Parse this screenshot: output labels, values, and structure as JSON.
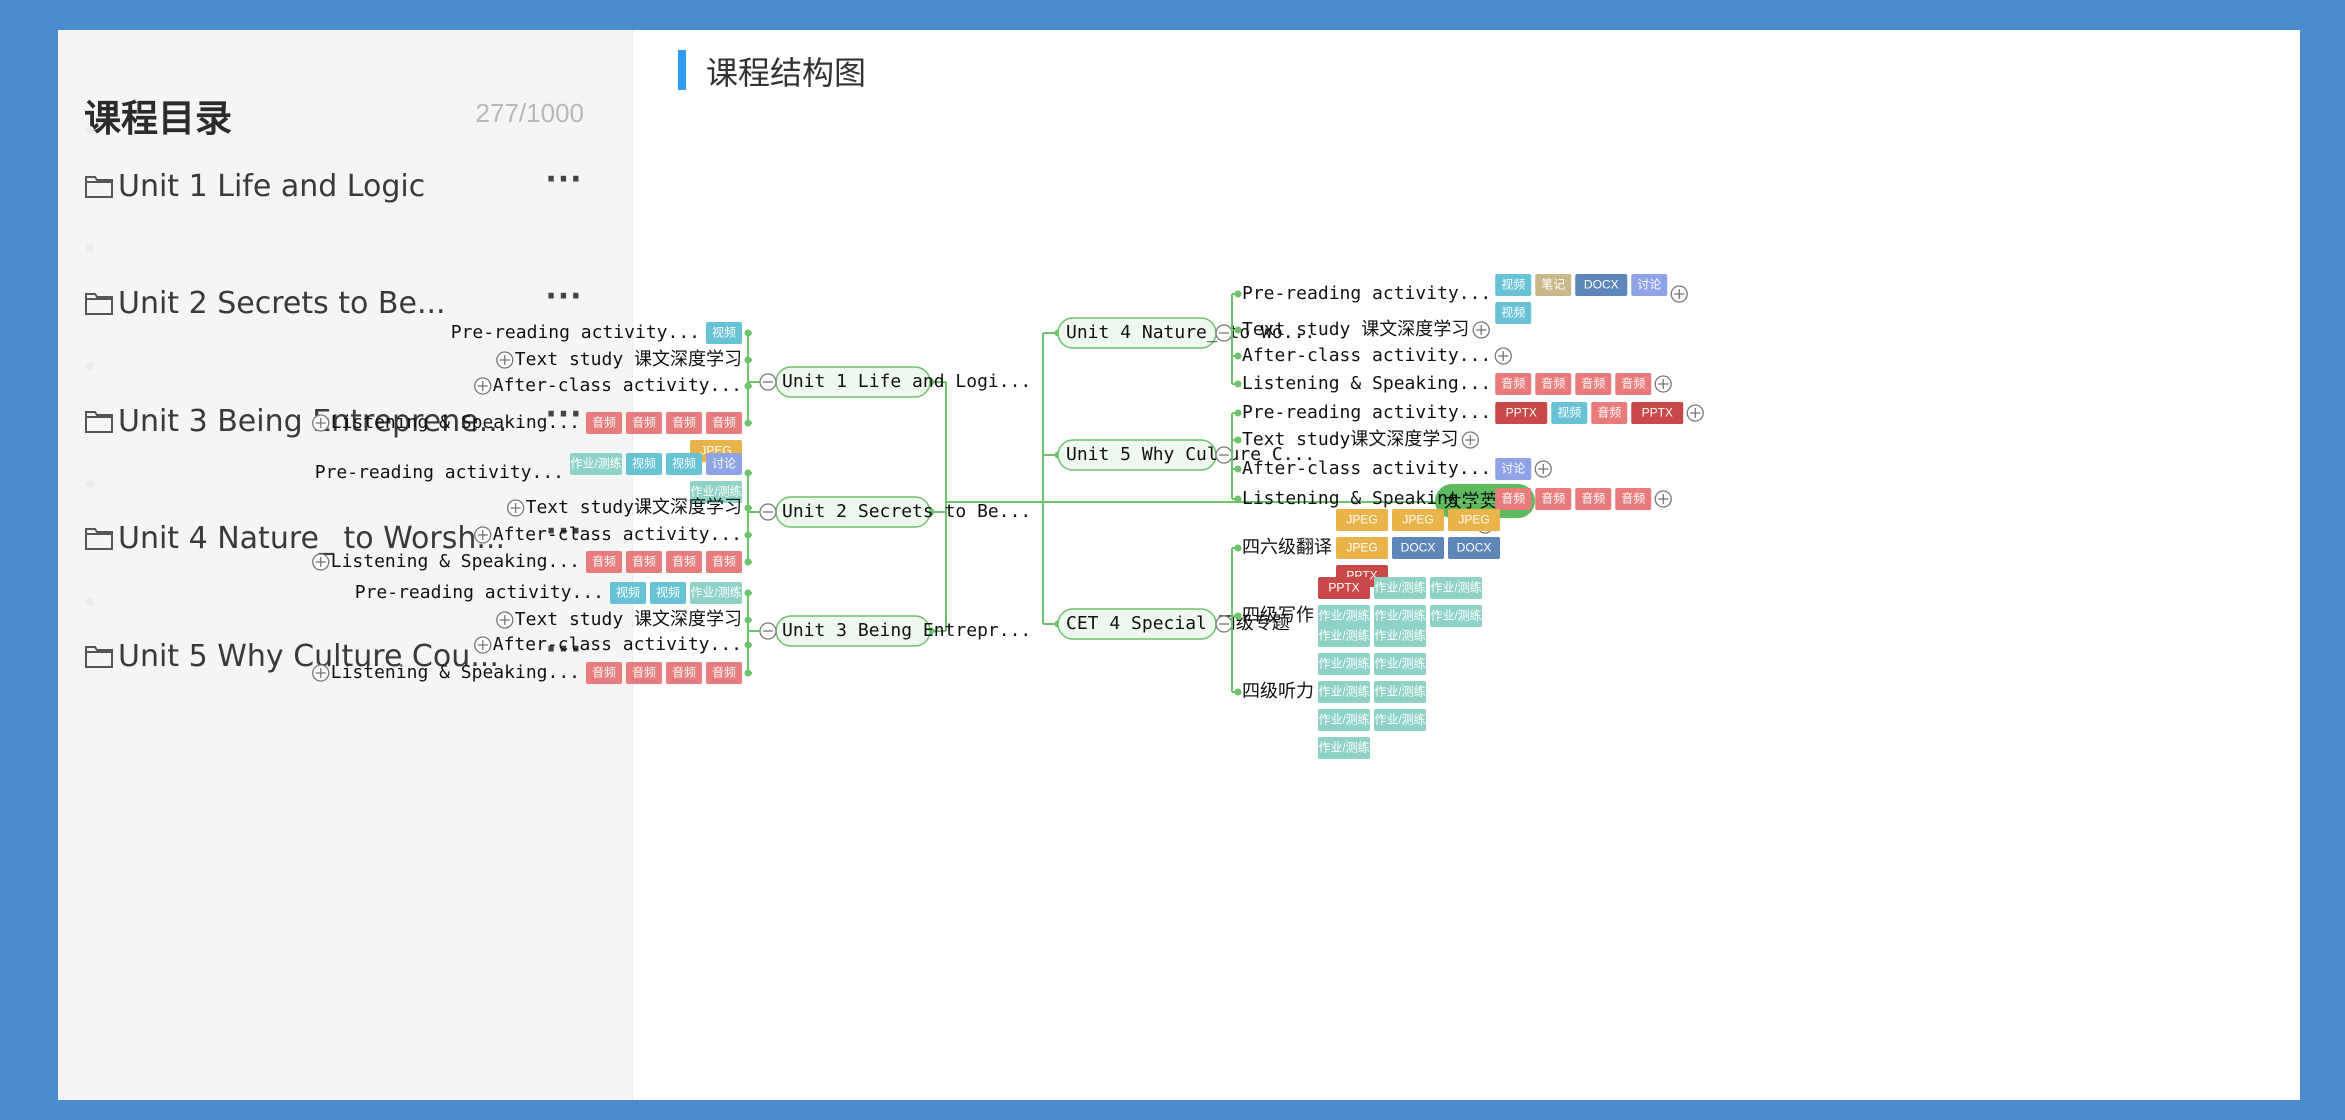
{
  "sidebar": {
    "title": "课程目录",
    "count": "277/1000",
    "items": [
      {
        "label": "Unit 1 Life and Logic"
      },
      {
        "label": "Unit 2 Secrets to Be..."
      },
      {
        "label": "Unit 3 Being Entreprene..."
      },
      {
        "label": "Unit 4 Nature_ to Worsh..."
      },
      {
        "label": "Unit 5 Why Culture Cou..."
      }
    ],
    "more_label": "···"
  },
  "main": {
    "title": "课程结构图"
  },
  "mindmap": {
    "root": "大学英语3",
    "colors": {
      "line": "#6cc36c",
      "node_bg": "#eef8ee",
      "root_bg": "#5dbb5d",
      "音频": "#e87b7b",
      "视频": "#67c2d6",
      "作业/测练": "#8fd3c6",
      "讨论": "#8fa3e6",
      "JPEG": "#e8b44a",
      "DOCX": "#5f86b8",
      "PPTX": "#c9494b",
      "笔记": "#c9b88a"
    },
    "left_units": [
      {
        "label": "Unit 1 Life and Logi...",
        "children": [
          {
            "label": "Pre-reading activity...",
            "tags": [
              "视频"
            ],
            "collapsed": false
          },
          {
            "label": "Text study 课文深度学习",
            "tags": [],
            "collapsed": true
          },
          {
            "label": "After-class activity...",
            "tags": [],
            "collapsed": true
          },
          {
            "label": "Listening & Speaking...",
            "tags": [
              "音频",
              "音频",
              "音频",
              "音频",
              "JPEG"
            ],
            "collapsed": true
          }
        ]
      },
      {
        "label": "Unit 2 Secrets to Be...",
        "children": [
          {
            "label": "Pre-reading activity...",
            "tags": [
              "作业/测练",
              "视频",
              "视频",
              "讨论",
              "作业/测练"
            ],
            "collapsed": false
          },
          {
            "label": "Text study课文深度学习",
            "tags": [],
            "collapsed": true
          },
          {
            "label": "After-class activity...",
            "tags": [],
            "collapsed": true
          },
          {
            "label": "Listening & Speaking...",
            "tags": [
              "音频",
              "音频",
              "音频",
              "音频"
            ],
            "collapsed": true
          }
        ]
      },
      {
        "label": "Unit 3 Being Entrepr...",
        "children": [
          {
            "label": "Pre-reading activity...",
            "tags": [
              "视频",
              "视频",
              "作业/测练"
            ],
            "collapsed": false
          },
          {
            "label": "Text study 课文深度学习",
            "tags": [],
            "collapsed": true
          },
          {
            "label": "After-class activity...",
            "tags": [],
            "collapsed": true
          },
          {
            "label": "Listening & Speaking...",
            "tags": [
              "音频",
              "音频",
              "音频",
              "音频"
            ],
            "collapsed": true
          }
        ]
      }
    ],
    "right_units": [
      {
        "label": "Unit 4 Nature_ to Wo...",
        "children": [
          {
            "label": "Pre-reading activity...",
            "tags": [
              "视频",
              "笔记",
              "DOCX",
              "讨论",
              "视频"
            ],
            "collapsed": true
          },
          {
            "label": "Text study 课文深度学习",
            "tags": [],
            "collapsed": true
          },
          {
            "label": "After-class activity...",
            "tags": [],
            "collapsed": true
          },
          {
            "label": "Listening & Speaking...",
            "tags": [
              "音频",
              "音频",
              "音频",
              "音频"
            ],
            "collapsed": true
          }
        ]
      },
      {
        "label": "Unit 5 Why Culture C...",
        "children": [
          {
            "label": "Pre-reading activity...",
            "tags": [
              "PPTX",
              "视频",
              "音频",
              "PPTX"
            ],
            "collapsed": true
          },
          {
            "label": "Text study课文深度学习",
            "tags": [],
            "collapsed": true
          },
          {
            "label": "After-class activity...",
            "tags": [
              "讨论"
            ],
            "collapsed": true
          },
          {
            "label": "Listening & Speaking...",
            "tags": [
              "音频",
              "音频",
              "音频",
              "音频"
            ],
            "collapsed": true
          }
        ]
      },
      {
        "label": "CET 4 Special 四级专题",
        "children": [
          {
            "label": "四六级翻译",
            "tags": [
              "JPEG",
              "JPEG",
              "JPEG",
              "JPEG",
              "DOCX",
              "DOCX",
              "PPTX"
            ],
            "collapsed": false
          },
          {
            "label": "四级写作",
            "tags": [
              "PPTX",
              "作业/测练",
              "作业/测练",
              "作业/测练",
              "作业/测练",
              "作业/测练"
            ],
            "collapsed": false
          },
          {
            "label": "四级听力",
            "tags": [
              "作业/测练",
              "作业/测练",
              "作业/测练",
              "作业/测练",
              "作业/测练",
              "作业/测练",
              "作业/测练",
              "作业/测练",
              "作业/测练"
            ],
            "collapsed": false
          }
        ]
      }
    ]
  }
}
